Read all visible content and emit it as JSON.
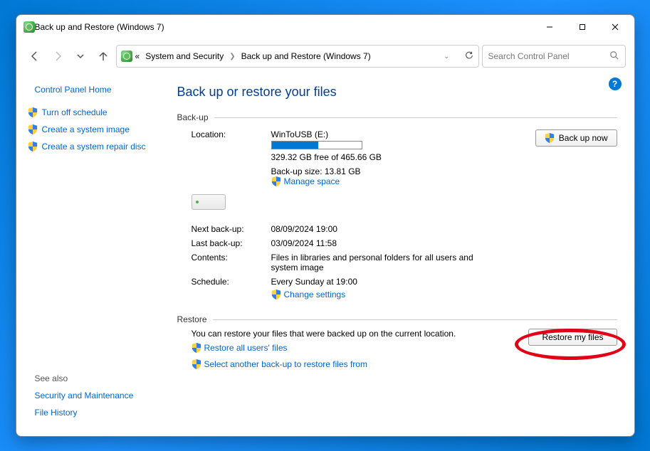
{
  "window": {
    "title": "Back up and Restore (Windows 7)"
  },
  "breadcrumb": {
    "prefix": "«",
    "item1": "System and Security",
    "item2": "Back up and Restore (Windows 7)"
  },
  "search": {
    "placeholder": "Search Control Panel"
  },
  "sidebar": {
    "home": "Control Panel Home",
    "link1": "Turn off schedule",
    "link2": "Create a system image",
    "link3": "Create a system repair disc",
    "seealso": "See also",
    "link4": "Security and Maintenance",
    "link5": "File History"
  },
  "main": {
    "heading": "Back up or restore your files",
    "backup_legend": "Back-up",
    "location_label": "Location:",
    "location_value": "WinToUSB (E:)",
    "free_space": "329.32 GB free of 465.66 GB",
    "backup_size": "Back-up size: 13.81 GB",
    "manage_space": "Manage space",
    "backup_now": "Back up now",
    "next_label": "Next back-up:",
    "next_value": "08/09/2024 19:00",
    "last_label": "Last back-up:",
    "last_value": "03/09/2024 11:58",
    "contents_label": "Contents:",
    "contents_value": "Files in libraries and personal folders for all users and system image",
    "schedule_label": "Schedule:",
    "schedule_value": "Every Sunday at 19:00",
    "change_settings": "Change settings",
    "restore_legend": "Restore",
    "restore_text": "You can restore your files that were backed up on the current location.",
    "restore_all": "Restore all users' files",
    "select_another": "Select another back-up to restore files from",
    "restore_my_files": "Restore my files"
  },
  "progress_pct": 52
}
